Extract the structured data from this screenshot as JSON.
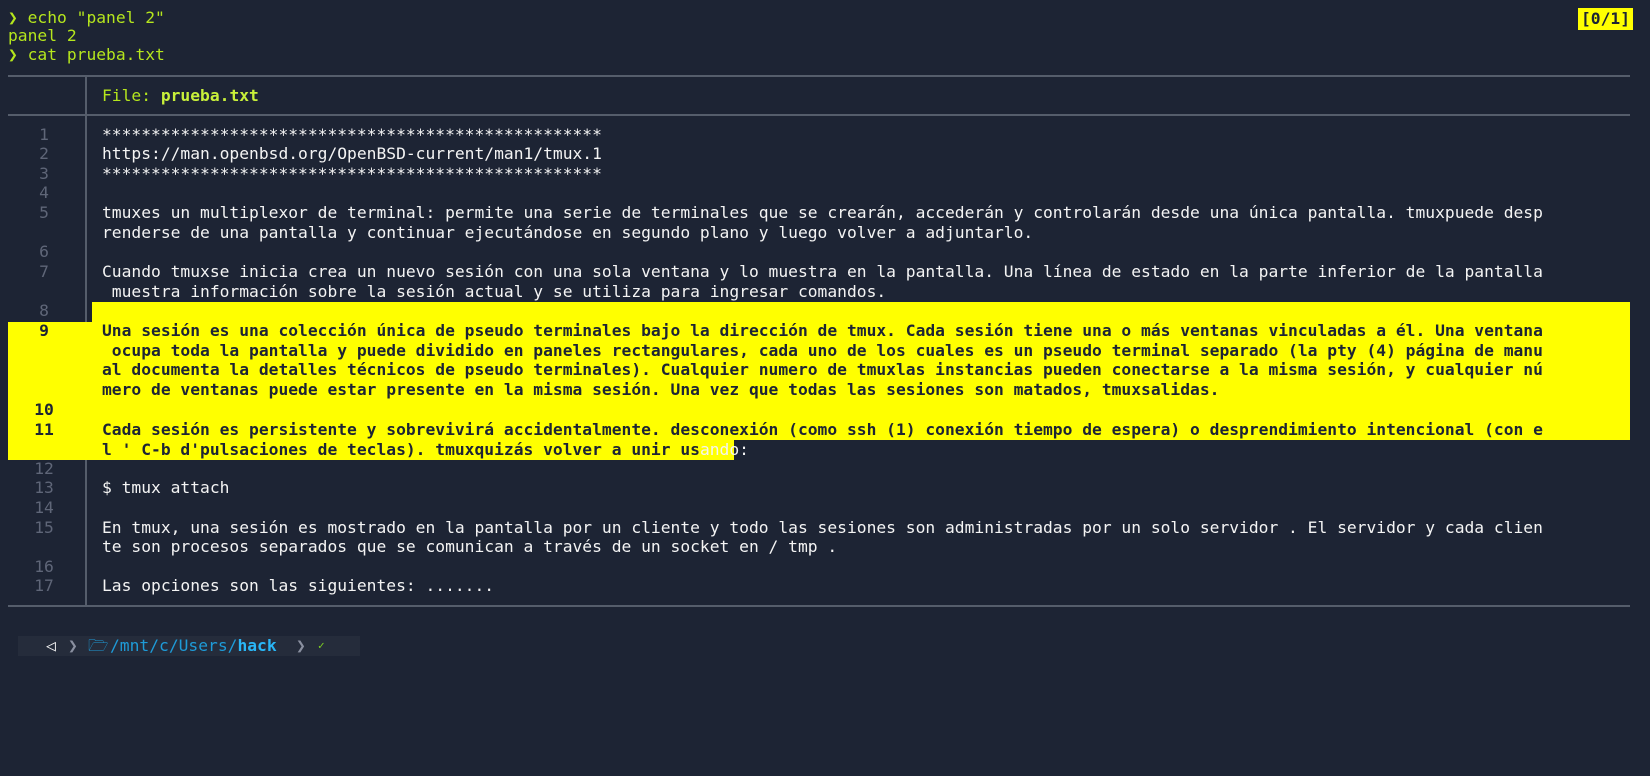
{
  "terminal": {
    "commands": [
      {
        "prompt": "❯",
        "command": "echo \"panel 2\""
      },
      {
        "output": "panel 2"
      },
      {
        "prompt": "❯",
        "command": "cat prueba.txt"
      }
    ],
    "pane_counter": "[0/1]"
  },
  "viewer": {
    "file_label": "File: ",
    "file_name": "prueba.txt",
    "line_numbers": [
      "1",
      "2",
      "3",
      "4",
      "5",
      "6",
      "7",
      "8",
      "9",
      "10",
      "11",
      "12",
      "13",
      "14",
      "15",
      "16",
      "17"
    ],
    "content": [
      "***************************************************",
      "https://man.openbsd.org/OpenBSD-current/man1/tmux.1",
      "***************************************************",
      "",
      "tmuxes un multiplexor de terminal: permite una serie de terminales que se crearán, accederán y controlarán desde una única pantalla. tmuxpuede desp",
      "renderse de una pantalla y continuar ejecutándose en segundo plano y luego volver a adjuntarlo.",
      "",
      "Cuando tmuxse inicia crea un nuevo sesión con una sola ventana y lo muestra en la pantalla. Una línea de estado en la parte inferior de la pantalla",
      " muestra información sobre la sesión actual y se utiliza para ingresar comandos.",
      "",
      "Una sesión es una colección única de pseudo terminales bajo la dirección de tmux. Cada sesión tiene una o más ventanas vinculadas a él. Una ventana",
      " ocupa toda la pantalla y puede dividido en paneles rectangulares, cada uno de los cuales es un pseudo terminal separado (la pty (4) página de manu",
      "al documenta la detalles técnicos de pseudo terminales). Cualquier numero de tmuxlas instancias pueden conectarse a la misma sesión, y cualquier nú",
      "mero de ventanas puede estar presente en la misma sesión. Una vez que todas las sesiones son matados, tmuxsalidas.",
      "",
      "Cada sesión es persistente y sobrevivirá accidentalmente. desconexión (como ssh (1) conexión tiempo de espera) o desprendimiento intencional (con e",
      "l ' C-b d'pulsaciones de teclas). tmuxquizás volver a unir us",
      "ando:",
      "",
      "$ tmux attach",
      "",
      "En tmux, una sesión es mostrado en la pantalla por un cliente y todo las sesiones son administradas por un solo servidor . El servidor y cada clien",
      "te son procesos separados que se comunican a través de un socket en / tmp .",
      "",
      "Las opciones son las siguientes: ......."
    ]
  },
  "statusbar": {
    "home_icon": "◁",
    "separator": "❯",
    "folder_icon": "🗁",
    "path_prefix": "/mnt/c/Users/",
    "path_current": "hack",
    "status_icon": "✓"
  },
  "colors": {
    "background": "#1d2434",
    "prompt": "#b5e61d",
    "highlight": "#ffff00",
    "path": "#1e9bd8"
  }
}
